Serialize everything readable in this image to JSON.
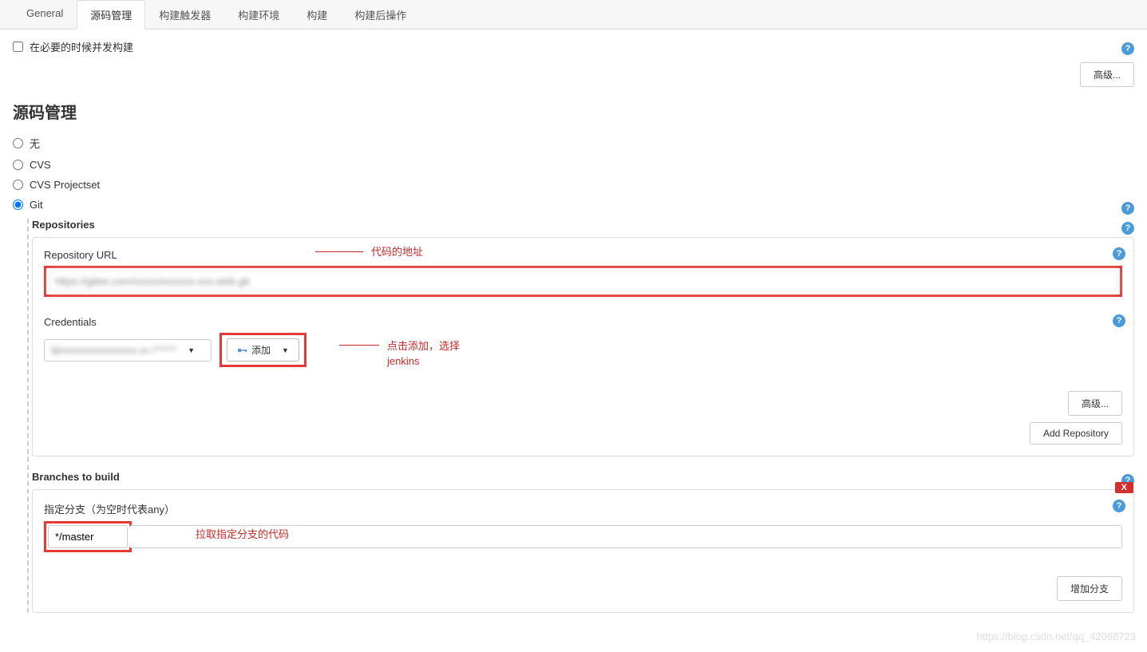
{
  "tabs": {
    "general": "General",
    "scm": "源码管理",
    "triggers": "构建触发器",
    "env": "构建环境",
    "build": "构建",
    "post": "构建后操作"
  },
  "concurrent_label": "在必要的时候并发构建",
  "advanced_btn": "高级...",
  "section_title": "源码管理",
  "scm_options": {
    "none": "无",
    "cvs": "CVS",
    "cvsproj": "CVS Projectset",
    "git": "Git"
  },
  "repositories_label": "Repositories",
  "repo_url_label": "Repository URL",
  "repo_url_value": "https://gitee.com/xxxxx/xxxxxx-xxx-web.git",
  "annot_repo": "代码的地址",
  "credentials_label": "Credentials",
  "cred_value": "lijinxxxxxxxxxxxxxxx.xx /******",
  "add_label": "添加",
  "annot_cred1": "点击添加，选择",
  "annot_cred2": "jenkins",
  "add_repo_btn": "Add Repository",
  "branches_label": "Branches to build",
  "branch_field_label": "指定分支（为空时代表any）",
  "branch_value": "*/master",
  "annot_branch": "拉取指定分支的代码",
  "add_branch_btn": "增加分支",
  "delete_x": "X",
  "watermark": "https://blog.csdn.net/qq_42068723",
  "help_char": "?"
}
